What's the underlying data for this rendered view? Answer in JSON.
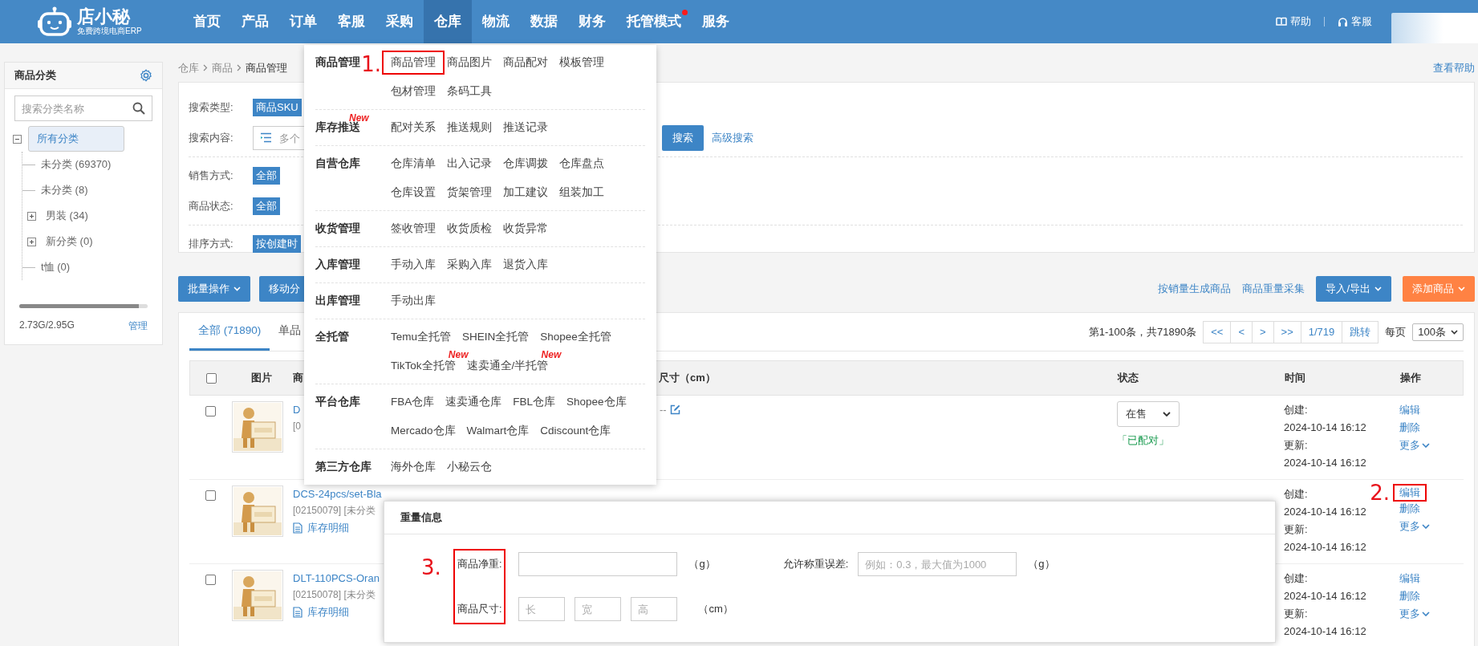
{
  "nav": {
    "logo": {
      "name": "店小秘",
      "tagline": "免费跨境电商ERP"
    },
    "items": [
      {
        "label": "首页",
        "selected": false,
        "dot": false
      },
      {
        "label": "产品",
        "selected": false,
        "dot": false
      },
      {
        "label": "订单",
        "selected": false,
        "dot": false
      },
      {
        "label": "客服",
        "selected": false,
        "dot": false
      },
      {
        "label": "采购",
        "selected": false,
        "dot": false
      },
      {
        "label": "仓库",
        "selected": true,
        "dot": false
      },
      {
        "label": "物流",
        "selected": false,
        "dot": false
      },
      {
        "label": "数据",
        "selected": false,
        "dot": false
      },
      {
        "label": "财务",
        "selected": false,
        "dot": false
      },
      {
        "label": "托管模式",
        "selected": false,
        "dot": true
      },
      {
        "label": "服务",
        "selected": false,
        "dot": false
      }
    ],
    "links": [
      {
        "kind": "help",
        "label": "帮助"
      },
      {
        "kind": "support",
        "label": "客服"
      }
    ]
  },
  "sidebar": {
    "title": "商品分类",
    "search": {
      "placeholder": "搜索分类名称"
    },
    "tree": [
      {
        "label": "所有分类",
        "expanded": true,
        "selected": true,
        "children": [
          {
            "label": "未分类 (69370)",
            "selected": false
          },
          {
            "label": "未分类 (8)",
            "selected": false
          },
          {
            "label": "男装 (34)",
            "expanded": false,
            "selected": false
          },
          {
            "label": "新分类 (0)",
            "expanded": false,
            "selected": false
          },
          {
            "label": "t恤 (0)",
            "selected": false
          }
        ]
      }
    ],
    "storage": {
      "level": 0.93,
      "text": "2.73G/2.95G",
      "link": "管理"
    }
  },
  "breadcrumb": [
    "仓库",
    "商品",
    "商品管理"
  ],
  "help_link": "查看帮助",
  "filter_groups": [
    [
      {
        "kind": "tag",
        "label": "搜索类型:",
        "value": "商品SKU"
      },
      {
        "kind": "search",
        "label": "搜索内容:",
        "placeholder": "多个",
        "button": "搜索",
        "link": "高级搜索"
      }
    ],
    [
      {
        "kind": "tag",
        "label": "销售方式:",
        "value": "全部"
      },
      {
        "kind": "tag",
        "label": "商品状态:",
        "value": "全部"
      }
    ],
    [
      {
        "kind": "tag",
        "label": "排序方式:",
        "value": "按创建时"
      }
    ]
  ],
  "toolbar": {
    "left": [
      {
        "label": "批量操作",
        "caret": true
      },
      {
        "label": "移动分",
        "caret": false
      }
    ],
    "links": [
      "按销量生成商品",
      "商品重量采集"
    ],
    "right": [
      {
        "label": "导入/导出",
        "kind": "primary",
        "caret": true
      },
      {
        "label": "添加商品",
        "kind": "accent",
        "caret": true
      }
    ]
  },
  "tabs": [
    {
      "label": "全部 (71890)",
      "selected": true
    },
    {
      "label": "单品",
      "selected": false
    }
  ],
  "pagination": {
    "summary": "第1-100条，共71890条",
    "buttons": [
      "<<",
      "<",
      ">",
      ">>",
      "1/719",
      "跳转"
    ],
    "per_page_label": "每页",
    "per_page": "100条"
  },
  "table": {
    "header_checked": false,
    "columns": [
      "图片",
      "商",
      "尺寸（cm）",
      "状态",
      "时间",
      "操作"
    ],
    "rows": [
      {
        "checked": false,
        "name": "D",
        "meta": "[0",
        "size": "--",
        "status": "在售",
        "pairing": "「已配对」",
        "created_label": "创建:",
        "created": "2024-10-14 16:12",
        "updated_label": "更新:",
        "updated": "2024-10-14 16:12",
        "actions": [
          {
            "label": "编辑",
            "caret": false
          },
          {
            "label": "删除",
            "caret": false
          },
          {
            "label": "更多",
            "caret": true
          }
        ]
      },
      {
        "checked": false,
        "name": "DCS-24pcs/set-Bla",
        "meta": "[02150079] [未分类",
        "stock_link": "库存明细",
        "created_label": "创建:",
        "created": "2024-10-14 16:12",
        "updated_label": "更新:",
        "updated": "2024-10-14 16:12",
        "actions": [
          {
            "label": "编辑",
            "caret": false,
            "annotation": "2."
          },
          {
            "label": "删除",
            "caret": false
          },
          {
            "label": "更多",
            "caret": true
          }
        ]
      },
      {
        "checked": false,
        "name": "DLT-110PCS-Oran",
        "meta": "[02150078] [未分类",
        "stock_link": "库存明细",
        "created_label": "创建:",
        "created": "2024-10-14 16:12",
        "updated_label": "更新:",
        "updated": "2024-10-14 16:12",
        "actions": [
          {
            "label": "编辑",
            "caret": false
          },
          {
            "label": "删除",
            "caret": false
          },
          {
            "label": "更多",
            "caret": true
          }
        ]
      }
    ]
  },
  "dropdown": {
    "sections": [
      {
        "title": "商品管理",
        "rows": [
          [
            {
              "label": "商品管理",
              "annotation": "1."
            },
            {
              "label": "商品图片"
            },
            {
              "label": "商品配对"
            },
            {
              "label": "模板管理"
            }
          ],
          [
            {
              "label": "包材管理"
            },
            {
              "label": "条码工具"
            }
          ]
        ]
      },
      {
        "title": "库存推送",
        "new": "New",
        "rows": [
          [
            {
              "label": "配对关系"
            },
            {
              "label": "推送规则"
            },
            {
              "label": "推送记录"
            }
          ]
        ]
      },
      {
        "title": "自营仓库",
        "rows": [
          [
            {
              "label": "仓库清单"
            },
            {
              "label": "出入记录"
            },
            {
              "label": "仓库调拨"
            },
            {
              "label": "仓库盘点"
            }
          ],
          [
            {
              "label": "仓库设置"
            },
            {
              "label": "货架管理"
            },
            {
              "label": "加工建议"
            },
            {
              "label": "组装加工"
            }
          ]
        ]
      },
      {
        "title": "收货管理",
        "rows": [
          [
            {
              "label": "签收管理"
            },
            {
              "label": "收货质检"
            },
            {
              "label": "收货异常"
            }
          ]
        ]
      },
      {
        "title": "入库管理",
        "rows": [
          [
            {
              "label": "手动入库"
            },
            {
              "label": "采购入库"
            },
            {
              "label": "退货入库"
            }
          ]
        ]
      },
      {
        "title": "出库管理",
        "rows": [
          [
            {
              "label": "手动出库"
            }
          ]
        ]
      },
      {
        "title": "全托管",
        "rows": [
          [
            {
              "label": "Temu全托管"
            },
            {
              "label": "SHEIN全托管"
            },
            {
              "label": "Shopee全托管"
            }
          ],
          [
            {
              "label": "TikTok全托管",
              "new": "New"
            },
            {
              "label": "速卖通全/半托管",
              "new": "New"
            }
          ]
        ]
      },
      {
        "title": "平台仓库",
        "rows": [
          [
            {
              "label": "FBA仓库"
            },
            {
              "label": "速卖通仓库"
            },
            {
              "label": "FBL仓库"
            },
            {
              "label": "Shopee仓库"
            }
          ],
          [
            {
              "label": "Mercado仓库"
            },
            {
              "label": "Walmart仓库"
            },
            {
              "label": "Cdiscount仓库"
            }
          ]
        ]
      },
      {
        "title": "第三方仓库",
        "rows": [
          [
            {
              "label": "海外仓库"
            },
            {
              "label": "小秘云仓"
            }
          ]
        ]
      }
    ]
  },
  "dialog": {
    "title": "重量信息",
    "annotation": "3.",
    "weight": {
      "label": "商品净重:",
      "unit": "（g）"
    },
    "tolerance": {
      "label": "允许称重误差:",
      "placeholder": "例如：0.3，最大值为1000",
      "unit": "（g）"
    },
    "size": {
      "label": "商品尺寸:",
      "placeholders": [
        "长",
        "宽",
        "高"
      ],
      "unit": "（cm）"
    }
  }
}
